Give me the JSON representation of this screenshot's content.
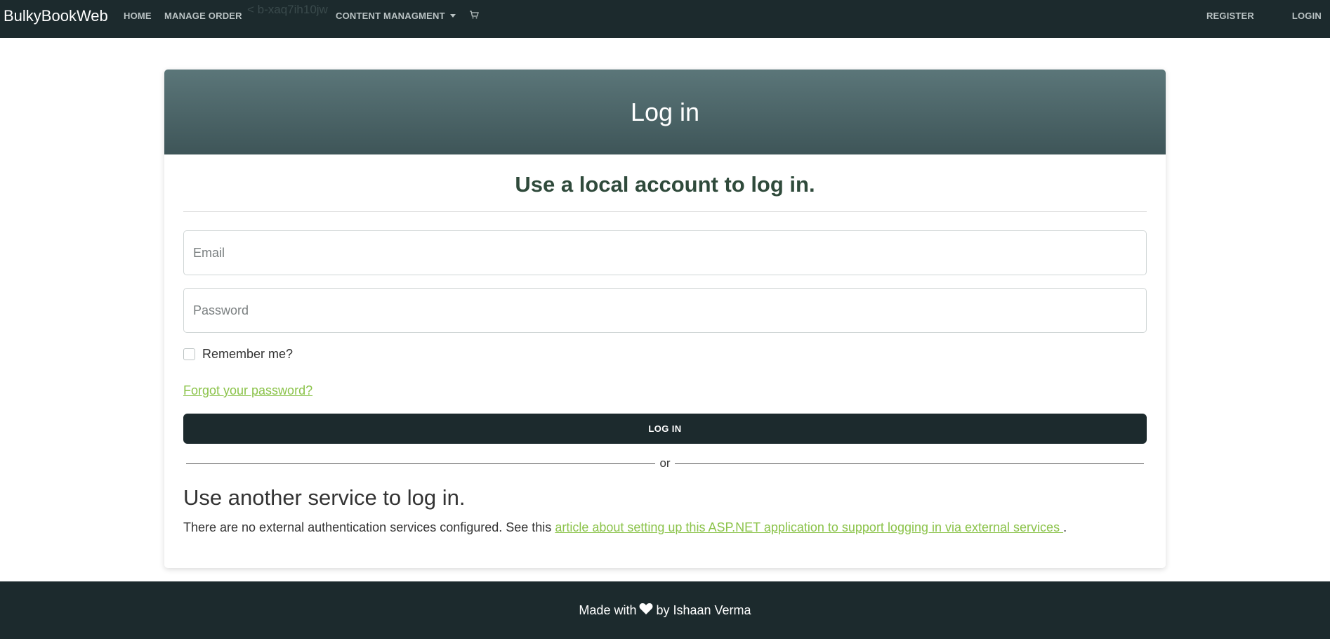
{
  "navbar": {
    "brand": "BulkyBookWeb",
    "home": "HOME",
    "manage_order": "MANAGE ORDER",
    "overlay_text": "< b-xaq7ih10jw",
    "content_management": "CONTENT MANAGMENT",
    "cart_icon": "cart-icon",
    "register": "REGISTER",
    "login": "LOGIN"
  },
  "card": {
    "header_title": "Log in",
    "subtitle": "Use a local account to log in.",
    "email_placeholder": "Email",
    "password_placeholder": "Password",
    "remember_label": "Remember me?",
    "forgot_link": "Forgot your password?",
    "login_button": "LOG IN",
    "or_text": "or",
    "other_title": "Use another service to log in.",
    "other_text": "There are no external authentication services configured. See this ",
    "other_link": "article about setting up this ASP.NET application to support logging in via external services ",
    "other_end": "."
  },
  "footer": {
    "prefix": "Made with",
    "heart_icon": "heart-icon",
    "suffix": "by Ishaan Verma"
  },
  "colors": {
    "navbar_bg": "#1c2a2d",
    "header_gradient_top": "#5b7679",
    "header_gradient_bottom": "#3e5558",
    "link_green": "#8bc34a",
    "subtitle_green": "#2f4a3b"
  }
}
